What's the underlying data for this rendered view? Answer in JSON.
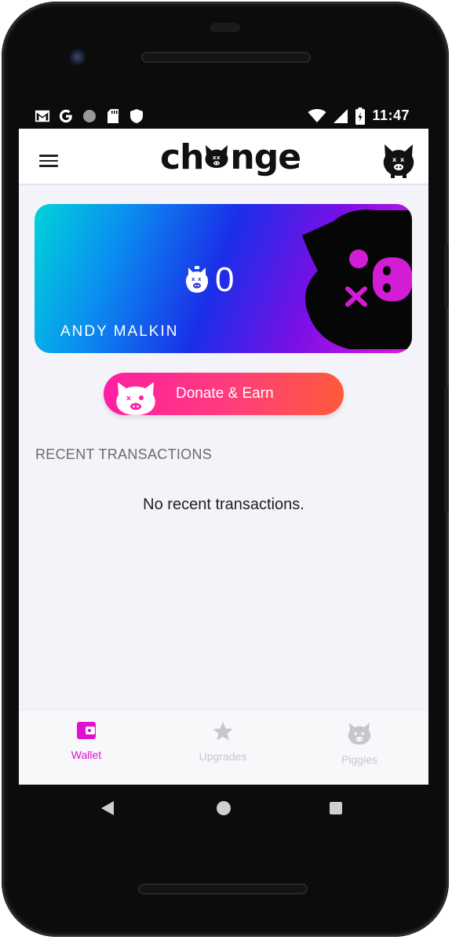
{
  "status": {
    "time": "11:47",
    "left_icons": [
      "gmail-icon",
      "google-icon",
      "circle-icon",
      "sd-card-icon",
      "shield-icon"
    ],
    "right_icons": [
      "wifi-icon",
      "signal-icon",
      "battery-icon"
    ]
  },
  "header": {
    "logo_prefix": "ch",
    "logo_suffix": "nge",
    "menu_icon": "hamburger-menu-icon",
    "avatar_icon": "pig-avatar-icon"
  },
  "card": {
    "balance": "0",
    "holder_name": "ANDY MALKIN",
    "gradient": [
      "#00d3d8",
      "#1a2fe8",
      "#e21ad9"
    ]
  },
  "donate": {
    "label": "Donate & Earn"
  },
  "transactions": {
    "title": "RECENT TRANSACTIONS",
    "empty_message": "No recent transactions."
  },
  "bottom_nav": {
    "items": [
      {
        "label": "Wallet",
        "icon": "wallet-icon",
        "active": true
      },
      {
        "label": "Upgrades",
        "icon": "star-icon",
        "active": false
      },
      {
        "label": "Piggies",
        "icon": "pig-icon",
        "active": false
      }
    ]
  },
  "colors": {
    "accent": "#e10fcf",
    "inactive": "#c6c6ce",
    "background": "#f4f3f9"
  }
}
